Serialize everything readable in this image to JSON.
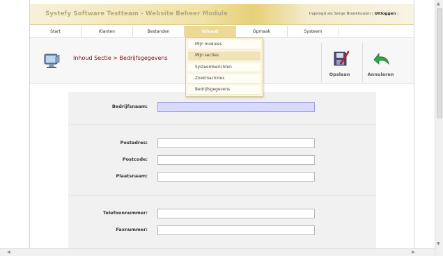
{
  "header": {
    "title": "Systefy Software Testteam - Website Beheer Module",
    "login_prefix": "Ingelogd als",
    "user": "Serge Broekhuizen",
    "separator_left": "|",
    "logout": "Uitloggen",
    "separator_right": "|"
  },
  "nav": {
    "items": [
      "Start",
      "Klanten",
      "Bestanden",
      "Inhoud",
      "Opmaak",
      "Systeem",
      ""
    ],
    "active": "Inhoud"
  },
  "dropdown": {
    "items": [
      "Mijn modules",
      "Mijn secties",
      "Systeemberichten",
      "Zoekmachines",
      "Bedrijfsgegevens"
    ],
    "hover": "Mijn secties"
  },
  "section": {
    "title": "Inhoud Sectie > Bedrijfsgegevens",
    "save_label": "Opslaan",
    "cancel_label": "Annuleren"
  },
  "form": {
    "bedrijfsnaam": {
      "label": "Bedrijfsnaam:",
      "value": ""
    },
    "postadres": {
      "label": "Postadres:",
      "value": ""
    },
    "postcode": {
      "label": "Postcode:",
      "value": ""
    },
    "plaatsnaam": {
      "label": "Plaatsnaam:",
      "value": ""
    },
    "telefoonnummer": {
      "label": "Telefoonnummer:",
      "value": ""
    },
    "faxnummer": {
      "label": "Faxnummer:",
      "value": ""
    }
  },
  "colors": {
    "accent_gold": "#ecd994",
    "title_red": "#7a1212",
    "focus_fill": "#d9d8ff"
  },
  "icons": {
    "section": "monitor-icon",
    "save": "save-icon",
    "cancel": "undo-arrow-icon"
  }
}
